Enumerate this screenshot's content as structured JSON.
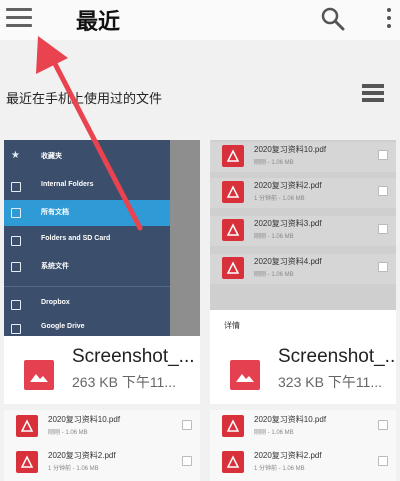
{
  "header": {
    "title": "最近"
  },
  "section": {
    "title": "最近在手机上使用过的文件"
  },
  "drawer": {
    "items": [
      {
        "label": "收藏夹"
      },
      {
        "label": "Internal Folders"
      },
      {
        "label": "所有文档"
      },
      {
        "label": "Folders and SD Card"
      },
      {
        "label": "系统文件"
      },
      {
        "label": "Dropbox"
      },
      {
        "label": "Google Drive"
      }
    ]
  },
  "cards": [
    {
      "name": "Screenshot_...",
      "meta": "263 KB  下午11..."
    },
    {
      "name": "Screenshot_...",
      "meta": "323 KB  下午11..."
    }
  ],
  "right_thumb_files": [
    {
      "name": "2020复习资料10.pdf",
      "meta": "刚刚 - 1.06 MB"
    },
    {
      "name": "2020复习资料2.pdf",
      "meta": "1 分钟前 - 1.06 MB"
    },
    {
      "name": "2020复习资料3.pdf",
      "meta": "刚刚 - 1.06 MB"
    },
    {
      "name": "2020复习资料4.pdf",
      "meta": "刚刚 - 1.06 MB"
    }
  ],
  "details_sheet": {
    "label": "详情"
  },
  "bottom_left_files": [
    {
      "name": "2020复习资料10.pdf",
      "meta": "刚刚 - 1.06 MB"
    },
    {
      "name": "2020复习资料2.pdf",
      "meta": "1 分钟前 - 1.06 MB"
    }
  ],
  "bottom_right_files": [
    {
      "name": "2020复习资料10.pdf",
      "meta": "刚刚 - 1.06 MB"
    },
    {
      "name": "2020复习资料2.pdf",
      "meta": "1 分钟前 - 1.06 MB"
    }
  ],
  "colors": {
    "accent_red": "#d9313b",
    "drawer_bg": "#3b4f6c",
    "drawer_active": "#2f9bd6",
    "arrow": "#e8434f"
  }
}
